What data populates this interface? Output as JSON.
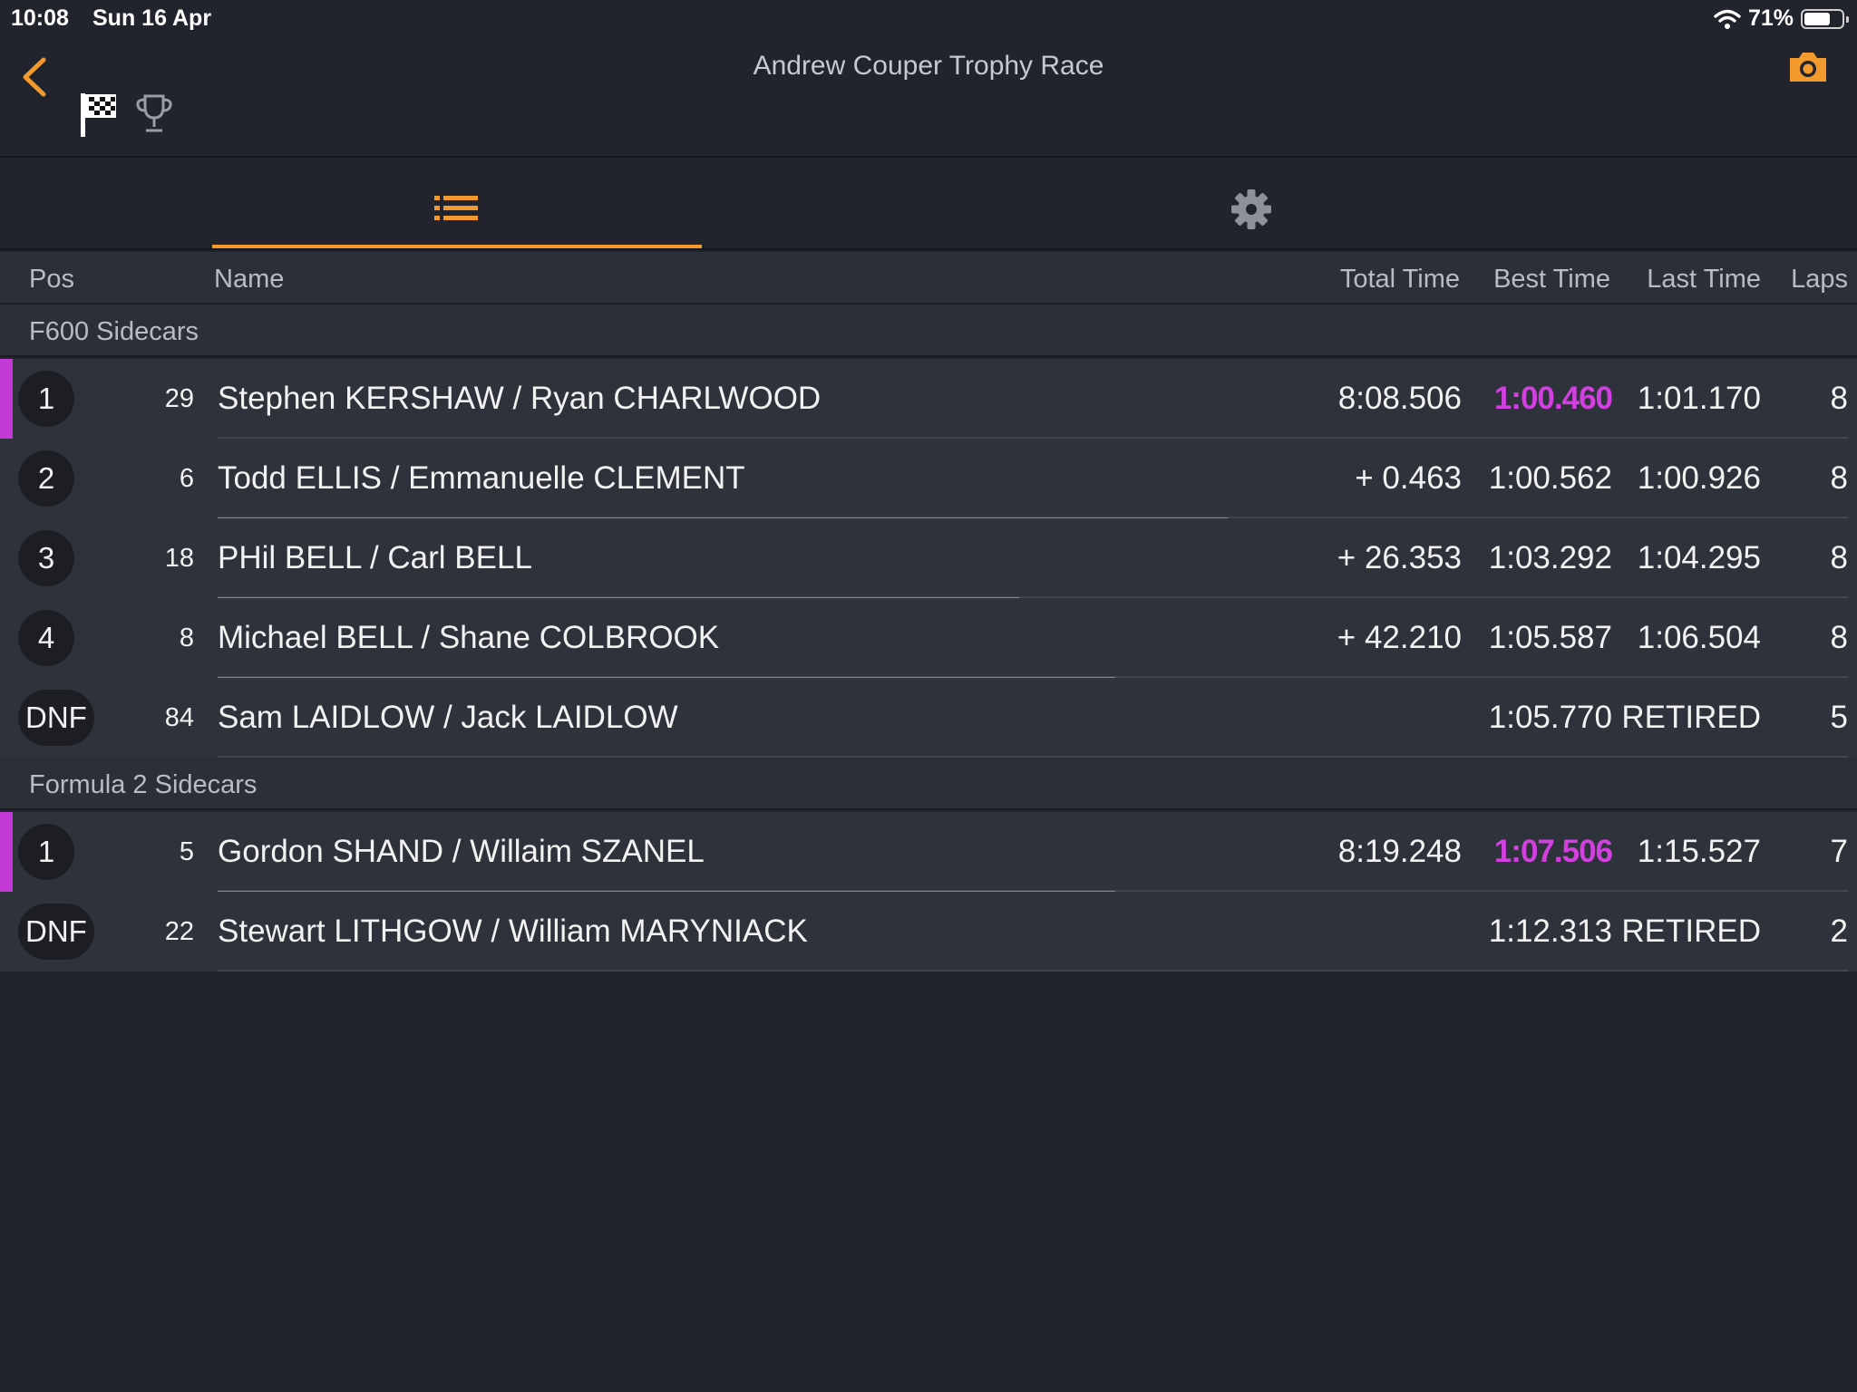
{
  "status": {
    "time": "10:08",
    "date": "Sun 16 Apr",
    "battery": "71%",
    "battery_level": 0.71
  },
  "header": {
    "title": "Andrew Couper Trophy Race",
    "icons": [
      "back-chevron-icon",
      "checkered-flag-icon",
      "trophy-icon",
      "camera-icon"
    ]
  },
  "tabs": [
    {
      "name": "list",
      "icon": "list-icon",
      "active": true
    },
    {
      "name": "settings",
      "icon": "gear-icon",
      "active": false
    }
  ],
  "columns": {
    "pos": "Pos",
    "name": "Name",
    "total": "Total Time",
    "best": "Best Time",
    "last": "Last Time",
    "laps": "Laps"
  },
  "colors": {
    "accent": "#f39a2e",
    "fastest": "#d240e0",
    "gap_line": "#2fa8c6"
  },
  "groups": [
    {
      "title": "F600 Sidecars",
      "rows": [
        {
          "pos": "1",
          "num": "29",
          "name": "Stephen KERSHAW / Ryan CHARLWOOD",
          "total": "8:08.506",
          "best": "1:00.460",
          "last": "1:01.170",
          "laps": "8",
          "leader": true,
          "fastest": true
        },
        {
          "pos": "2",
          "num": "6",
          "name": "Todd ELLIS / Emmanuelle CLEMENT",
          "total": "+ 0.463",
          "best": "1:00.562",
          "last": "1:00.926",
          "laps": "8",
          "progress": 0.63
        },
        {
          "pos": "3",
          "num": "18",
          "name": "PHil BELL / Carl BELL",
          "total": "+ 26.353",
          "best": "1:03.292",
          "last": "1:04.295",
          "laps": "8",
          "progress": 0.5
        },
        {
          "pos": "4",
          "num": "8",
          "name": "Michael BELL / Shane COLBROOK",
          "total": "+ 42.210",
          "best": "1:05.587",
          "last": "1:06.504",
          "laps": "8",
          "progress": 0.56
        },
        {
          "pos": "DNF",
          "num": "84",
          "name": "Sam LAIDLOW / Jack LAIDLOW",
          "total": "",
          "best": "1:05.770",
          "last": "RETIRED",
          "laps": "5"
        }
      ]
    },
    {
      "title": "Formula 2 Sidecars",
      "rows": [
        {
          "pos": "1",
          "num": "5",
          "name": "Gordon SHAND /  Willaim SZANEL",
          "total": "8:19.248",
          "best": "1:07.506",
          "last": "1:15.527",
          "laps": "7",
          "leader": true,
          "fastest": true,
          "progress": 0.56
        },
        {
          "pos": "DNF",
          "num": "22",
          "name": "Stewart LITHGOW / William MARYNIACK",
          "total": "",
          "best": "1:12.313",
          "last": "RETIRED",
          "laps": "2"
        }
      ]
    }
  ]
}
